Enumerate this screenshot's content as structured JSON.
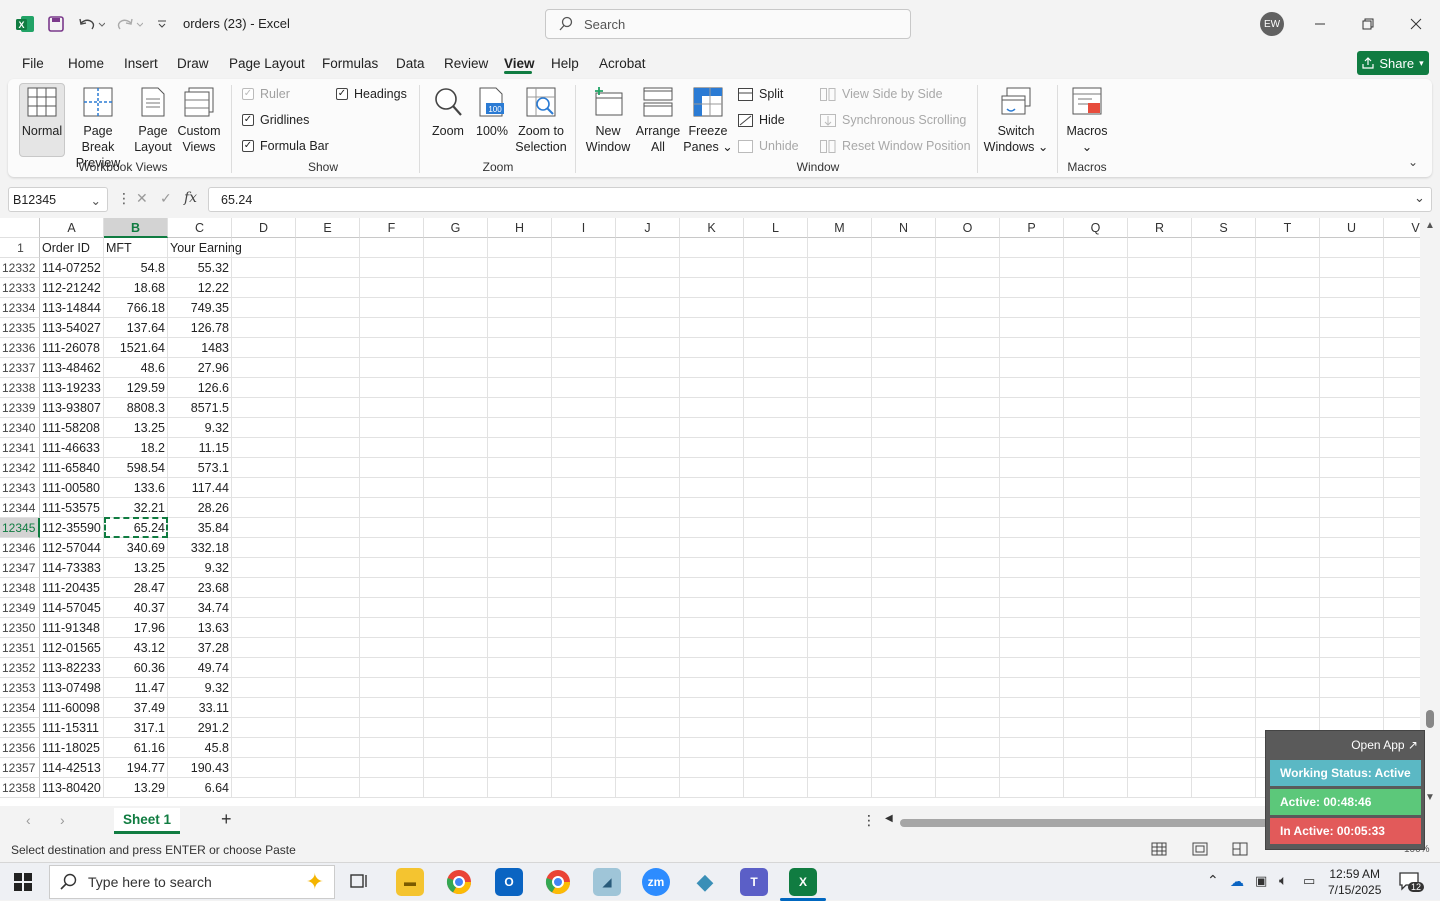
{
  "app": {
    "title": "orders (23)  -  Excel"
  },
  "search": {
    "placeholder": "Search"
  },
  "user": {
    "initials": "EW"
  },
  "menu": {
    "items": [
      "File",
      "Home",
      "Insert",
      "Draw",
      "Page Layout",
      "Formulas",
      "Data",
      "Review",
      "View",
      "Help",
      "Acrobat"
    ],
    "active": "View",
    "share": "Share"
  },
  "ribbon": {
    "workbook_views": {
      "normal": "Normal",
      "page_break_1": "Page Break",
      "page_break_2": "Preview",
      "page_layout_1": "Page",
      "page_layout_2": "Layout",
      "custom_1": "Custom",
      "custom_2": "Views",
      "group": "Workbook Views"
    },
    "show": {
      "ruler": "Ruler",
      "gridlines": "Gridlines",
      "formula_bar": "Formula Bar",
      "headings": "Headings",
      "group": "Show"
    },
    "zoom": {
      "zoom": "Zoom",
      "hundred": "100%",
      "to_sel_1": "Zoom to",
      "to_sel_2": "Selection",
      "group": "Zoom"
    },
    "window": {
      "new_1": "New",
      "new_2": "Window",
      "arrange_1": "Arrange",
      "arrange_2": "All",
      "freeze_1": "Freeze",
      "freeze_2": "Panes",
      "split": "Split",
      "hide": "Hide",
      "unhide": "Unhide",
      "side_by_side": "View Side by Side",
      "sync": "Synchronous Scrolling",
      "reset": "Reset Window Position",
      "switch_1": "Switch",
      "switch_2": "Windows",
      "group": "Window"
    },
    "macros": {
      "label": "Macros",
      "group": "Macros"
    }
  },
  "formula": {
    "name_box": "B12345",
    "value": "65.24"
  },
  "columns": [
    "A",
    "B",
    "C",
    "D",
    "E",
    "F",
    "G",
    "H",
    "I",
    "J",
    "K",
    "L",
    "M",
    "N",
    "O",
    "P",
    "Q",
    "R",
    "S",
    "T",
    "U",
    "V"
  ],
  "header_row": {
    "num": "1",
    "a": "Order ID",
    "b": "MFT",
    "c": "Your Earning"
  },
  "rows": [
    {
      "n": "12332",
      "a": "114-07252",
      "b": "54.8",
      "c": "55.32"
    },
    {
      "n": "12333",
      "a": "112-21242",
      "b": "18.68",
      "c": "12.22"
    },
    {
      "n": "12334",
      "a": "113-14844",
      "b": "766.18",
      "c": "749.35"
    },
    {
      "n": "12335",
      "a": "113-54027",
      "b": "137.64",
      "c": "126.78"
    },
    {
      "n": "12336",
      "a": "111-26078",
      "b": "1521.64",
      "c": "1483"
    },
    {
      "n": "12337",
      "a": "113-48462",
      "b": "48.6",
      "c": "27.96"
    },
    {
      "n": "12338",
      "a": "113-19233",
      "b": "129.59",
      "c": "126.6"
    },
    {
      "n": "12339",
      "a": "113-93807",
      "b": "8808.3",
      "c": "8571.5"
    },
    {
      "n": "12340",
      "a": "111-58208",
      "b": "13.25",
      "c": "9.32"
    },
    {
      "n": "12341",
      "a": "111-46633",
      "b": "18.2",
      "c": "11.15"
    },
    {
      "n": "12342",
      "a": "111-65840",
      "b": "598.54",
      "c": "573.1"
    },
    {
      "n": "12343",
      "a": "111-00580",
      "b": "133.6",
      "c": "117.44"
    },
    {
      "n": "12344",
      "a": "111-53575",
      "b": "32.21",
      "c": "28.26"
    },
    {
      "n": "12345",
      "a": "112-35590",
      "b": "65.24",
      "c": "35.84"
    },
    {
      "n": "12346",
      "a": "112-57044",
      "b": "340.69",
      "c": "332.18"
    },
    {
      "n": "12347",
      "a": "114-73383",
      "b": "13.25",
      "c": "9.32"
    },
    {
      "n": "12348",
      "a": "111-20435",
      "b": "28.47",
      "c": "23.68"
    },
    {
      "n": "12349",
      "a": "114-57045",
      "b": "40.37",
      "c": "34.74"
    },
    {
      "n": "12350",
      "a": "111-91348",
      "b": "17.96",
      "c": "13.63"
    },
    {
      "n": "12351",
      "a": "112-01565",
      "b": "43.12",
      "c": "37.28"
    },
    {
      "n": "12352",
      "a": "113-82233",
      "b": "60.36",
      "c": "49.74"
    },
    {
      "n": "12353",
      "a": "113-07498",
      "b": "11.47",
      "c": "9.32"
    },
    {
      "n": "12354",
      "a": "111-60098",
      "b": "37.49",
      "c": "33.11"
    },
    {
      "n": "12355",
      "a": "111-15311",
      "b": "317.1",
      "c": "291.2"
    },
    {
      "n": "12356",
      "a": "111-18025",
      "b": "61.16",
      "c": "45.8"
    },
    {
      "n": "12357",
      "a": "114-42513",
      "b": "194.77",
      "c": "190.43"
    },
    {
      "n": "12358",
      "a": "113-80420",
      "b": "13.29",
      "c": "6.64"
    }
  ],
  "selected_row": "12345",
  "sheet": {
    "tab": "Sheet 1"
  },
  "status": {
    "message": "Select destination and press ENTER or choose Paste",
    "zoom": "100%"
  },
  "widget": {
    "open_app": "Open App ↗",
    "status": "Working Status: Active",
    "active": "Active: 00:48:46",
    "inactive": "In Active: 00:05:33",
    "colors": {
      "status": "#5bb8c4",
      "active": "#5cc87a",
      "inactive": "#e25a5a"
    }
  },
  "taskbar": {
    "search": "Type here to search",
    "time": "12:59 AM",
    "date": "7/15/2025",
    "notifications": "12"
  },
  "colors": {
    "accent": "#107c41"
  }
}
